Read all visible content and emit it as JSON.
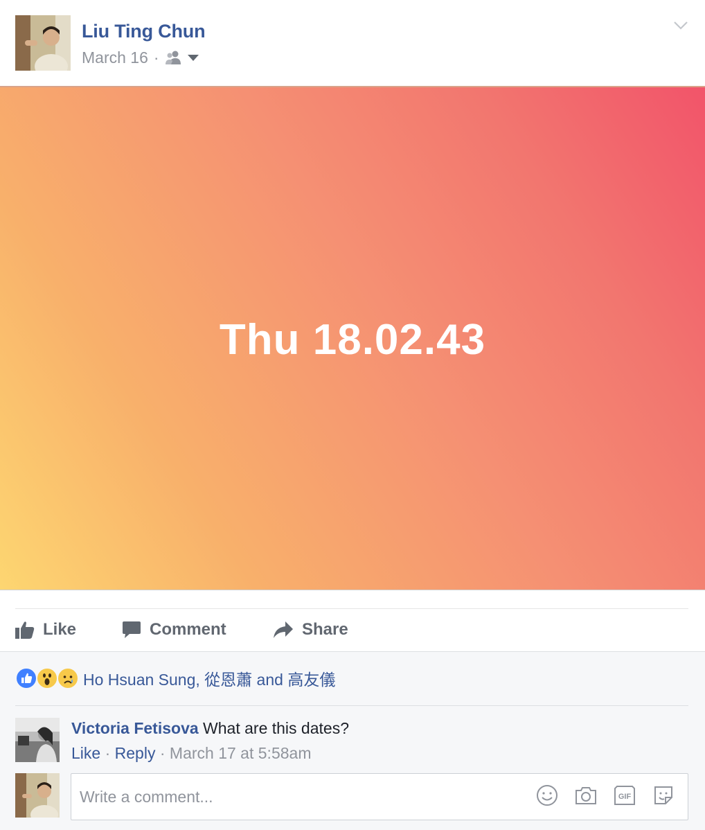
{
  "post": {
    "author": "Liu Ting Chun",
    "date": "March 16",
    "separator": "·",
    "status_text": "Thu 18.02.43"
  },
  "actions": {
    "like": "Like",
    "comment": "Comment",
    "share": "Share"
  },
  "reactions": {
    "types": [
      "like",
      "wow",
      "sad"
    ],
    "text": "Ho Hsuan Sung, 從恩蕭 and 高友儀"
  },
  "comments": [
    {
      "author": "Victoria Fetisova",
      "text": "What are this dates?",
      "like_label": "Like",
      "reply_label": "Reply",
      "separator": "·",
      "timestamp": "March 17 at 5:58am"
    }
  ],
  "composer": {
    "placeholder": "Write a comment..."
  },
  "colors": {
    "link": "#385898",
    "muted": "#90949c",
    "gradient_start": "#fdd671",
    "gradient_end": "#f2546a"
  }
}
